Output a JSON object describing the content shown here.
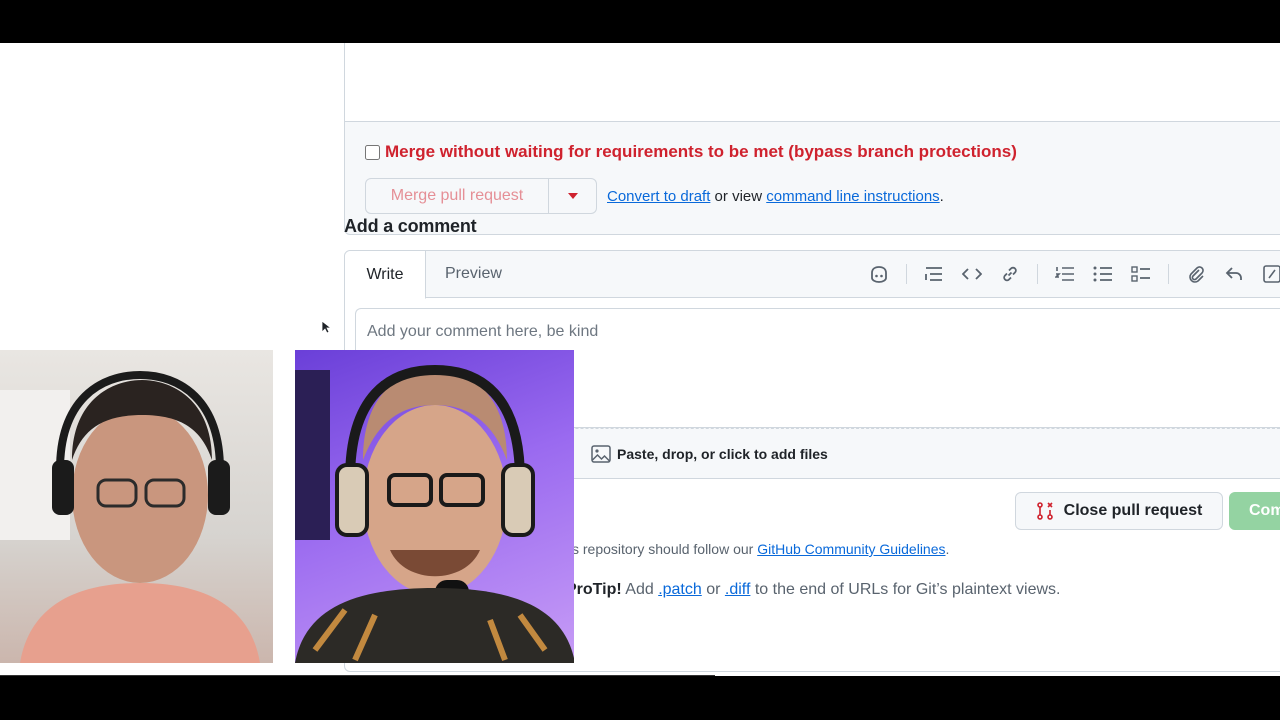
{
  "merge": {
    "bypass_label": "Merge without waiting for requirements to be met (bypass branch protections)",
    "merge_button": "Merge pull request",
    "convert_link": "Convert to draft",
    "or_view": " or view ",
    "cli_link": "command line instructions",
    "period": "."
  },
  "comment": {
    "title": "Add a comment",
    "tabs": {
      "write": "Write",
      "preview": "Preview"
    },
    "placeholder": "Add your comment here, be kind",
    "attach_label": "Paste, drop, or click to add files",
    "close_button": "Close pull request",
    "comment_button": "Comm"
  },
  "footer": {
    "guidelines_prefix": "s repository should follow our ",
    "guidelines_link": "GitHub Community Guidelines",
    "guidelines_suffix": ".",
    "protip_label": "ProTip!",
    "protip_add": " Add ",
    "patch_link": ".patch",
    "or": " or ",
    "diff_link": ".diff",
    "protip_rest": " to the end of URLs for Git’s plaintext views."
  },
  "icons": {
    "toolbar": [
      "copilot-icon",
      "heading-icon",
      "code-icon",
      "link-icon",
      "ordered-list-icon",
      "unordered-list-icon",
      "task-list-icon",
      "attach-icon",
      "reply-icon",
      "slash-command-icon"
    ]
  },
  "colors": {
    "danger": "#cf222e",
    "link": "#0969da",
    "success_disabled": "#94d3a2",
    "border": "#d0d7de"
  }
}
